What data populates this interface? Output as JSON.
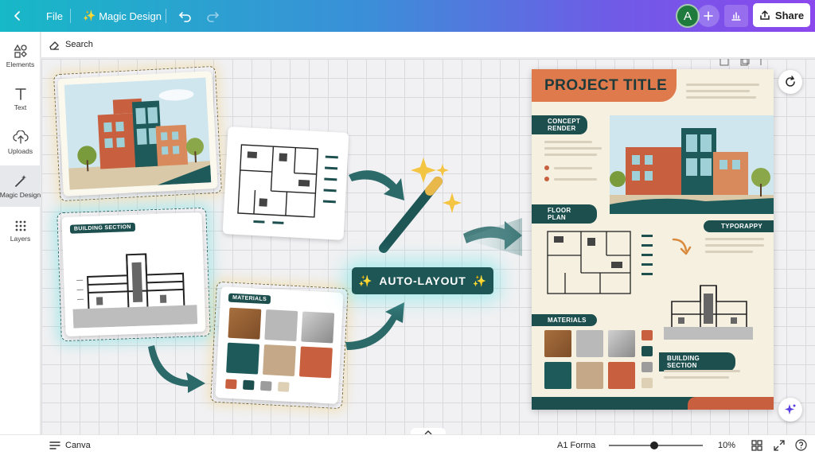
{
  "topbar": {
    "file_label": "File",
    "magic_design_label": "Magic Design",
    "magic_design_icon": "sparkles-icon",
    "avatar_initial": "A",
    "share_label": "Share",
    "gradient_colors": [
      "#17b8c7",
      "#3b8fd8",
      "#6f5be6",
      "#8b47ee"
    ]
  },
  "sidebar": {
    "items": [
      {
        "label": "Elements",
        "icon": "elements-icon"
      },
      {
        "label": "Text",
        "icon": "text-icon"
      },
      {
        "label": "Uploads",
        "icon": "cloud-upload-icon"
      },
      {
        "label": "Magic Design",
        "icon": "magic-wand-icon",
        "active": true
      },
      {
        "label": "Layers",
        "icon": "layers-icon"
      }
    ]
  },
  "search": {
    "label": "Search"
  },
  "canvas": {
    "building_section_tag": "BUILDING SECTION",
    "materials_tag": "MATERIALS",
    "auto_layout_label": "AUTO-LAYOUT",
    "accent_teal": "#1e5656",
    "accent_orange": "#de7a4c"
  },
  "poster": {
    "title": "PROJECT TITLE",
    "concept_render": "CONCEPT RENDER",
    "floor_plan": "FLOOR PLAN",
    "typorappy": "TYPORAPPY",
    "materials": "MATERIALS",
    "building_section": "BUILDING SECTION",
    "swatch_colors": [
      "#a0683c",
      "#b9b9b9",
      "#9c9c9c",
      "#1f5a5a",
      "#c4a888",
      "#c8603f"
    ],
    "accent_dot_colors": [
      "#c8603f",
      "#1d4f4f",
      "#9c9c9c",
      "#ddd0b4"
    ]
  },
  "bottombar": {
    "app_label": "Canva",
    "format_label": "A1 Forma",
    "zoom_label": "10%",
    "zoom_level": 0.1
  }
}
